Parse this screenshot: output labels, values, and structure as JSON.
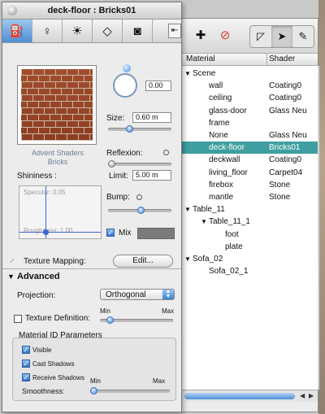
{
  "window": {
    "title": "deck-floor : Bricks01"
  },
  "tabs": [
    {
      "icon": "paint-bucket-icon",
      "glyph": "⛽"
    },
    {
      "icon": "lightbulb-icon",
      "glyph": "♀"
    },
    {
      "icon": "sun-icon",
      "glyph": "☀"
    },
    {
      "icon": "cube-icon",
      "glyph": "◇"
    },
    {
      "icon": "camera-icon",
      "glyph": "◙"
    }
  ],
  "material": {
    "thumbnail_caption_line1": "Advent Shaders",
    "thumbnail_caption_line2": "Bricks",
    "rotation_value": "0.00",
    "size_label": "Size:",
    "size_value": "0.60 m",
    "reflexion_label": "Reflexion:",
    "shininess_label": "Shininess :",
    "limit_label": "Limit:",
    "limit_value": "5.00 m",
    "specular_label": "Specular: 0.05",
    "roughness_label": "Roughness: 1.00",
    "bump_label": "Bump:",
    "mix_label": "Mix",
    "texture_mapping_label": "Texture Mapping:",
    "edit_button": "Edit..."
  },
  "advanced": {
    "title": "Advanced",
    "projection_label": "Projection:",
    "projection_value": "Orthogonal",
    "texture_definition_label": "Texture Definition:",
    "min_label": "Min",
    "max_label": "Max",
    "params_title": "Material ID Parameters",
    "visible_label": "Visible",
    "cast_shadows_label": "Cast Shadows",
    "receive_shadows_label": "Receive Shadows",
    "smoothness_label": "Smoothness:",
    "smooth_min": "Min",
    "smooth_max": "Max"
  },
  "list": {
    "col_material": "Material",
    "col_shader": "Shader",
    "rows": [
      {
        "name": "Scene",
        "shader": "",
        "depth": 0,
        "expanded": true
      },
      {
        "name": "wall",
        "shader": "Coating0",
        "depth": 1
      },
      {
        "name": "ceiling",
        "shader": "Coating0",
        "depth": 1
      },
      {
        "name": "glass-door",
        "shader": "Glass Neu",
        "depth": 1
      },
      {
        "name": "frame",
        "shader": "",
        "depth": 1
      },
      {
        "name": "None",
        "shader": "Glass Neu",
        "depth": 1
      },
      {
        "name": "deck-floor",
        "shader": "Bricks01",
        "depth": 1,
        "selected": true
      },
      {
        "name": "deckwall",
        "shader": "Coating0",
        "depth": 1
      },
      {
        "name": "living_floor",
        "shader": "Carpet04",
        "depth": 1
      },
      {
        "name": "firebox",
        "shader": "Stone",
        "depth": 1
      },
      {
        "name": "mantle",
        "shader": "Stone",
        "depth": 1
      },
      {
        "name": "Table_11",
        "shader": "",
        "depth": 0,
        "expanded": true
      },
      {
        "name": "Table_11_1",
        "shader": "",
        "depth": 1,
        "expanded": true
      },
      {
        "name": "foot",
        "shader": "",
        "depth": 2
      },
      {
        "name": "plate",
        "shader": "",
        "depth": 2
      },
      {
        "name": "Sofa_02",
        "shader": "",
        "depth": 0,
        "expanded": true
      },
      {
        "name": "Sofa_02_1",
        "shader": "",
        "depth": 1
      }
    ]
  }
}
